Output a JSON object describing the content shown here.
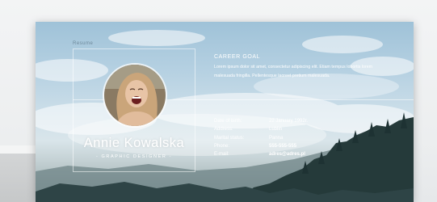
{
  "resume": {
    "label": "Resume",
    "name": "Annie Kowalska",
    "role": "- GRAPHIC DESIGNER -",
    "career_goal": {
      "title": "CAREER GOAL",
      "text": "Lorem ipsum dolor sit amet, consectetur adipiscing elit. Etiam tempus lobortis lorem malesuada fringilla. Pellentesque laoreet pretium malesuada."
    },
    "details": [
      {
        "label": "Date of birth:",
        "value": "22 January 1992r."
      },
      {
        "label": "Address:",
        "value": "Lublin"
      },
      {
        "label": "Marital status:",
        "value": "Panna"
      },
      {
        "label": "Phone:",
        "value": "555-555-555"
      },
      {
        "label": "E-mail:",
        "value": "adres@adres.pl"
      }
    ],
    "photo_icon": "portrait-photo"
  }
}
